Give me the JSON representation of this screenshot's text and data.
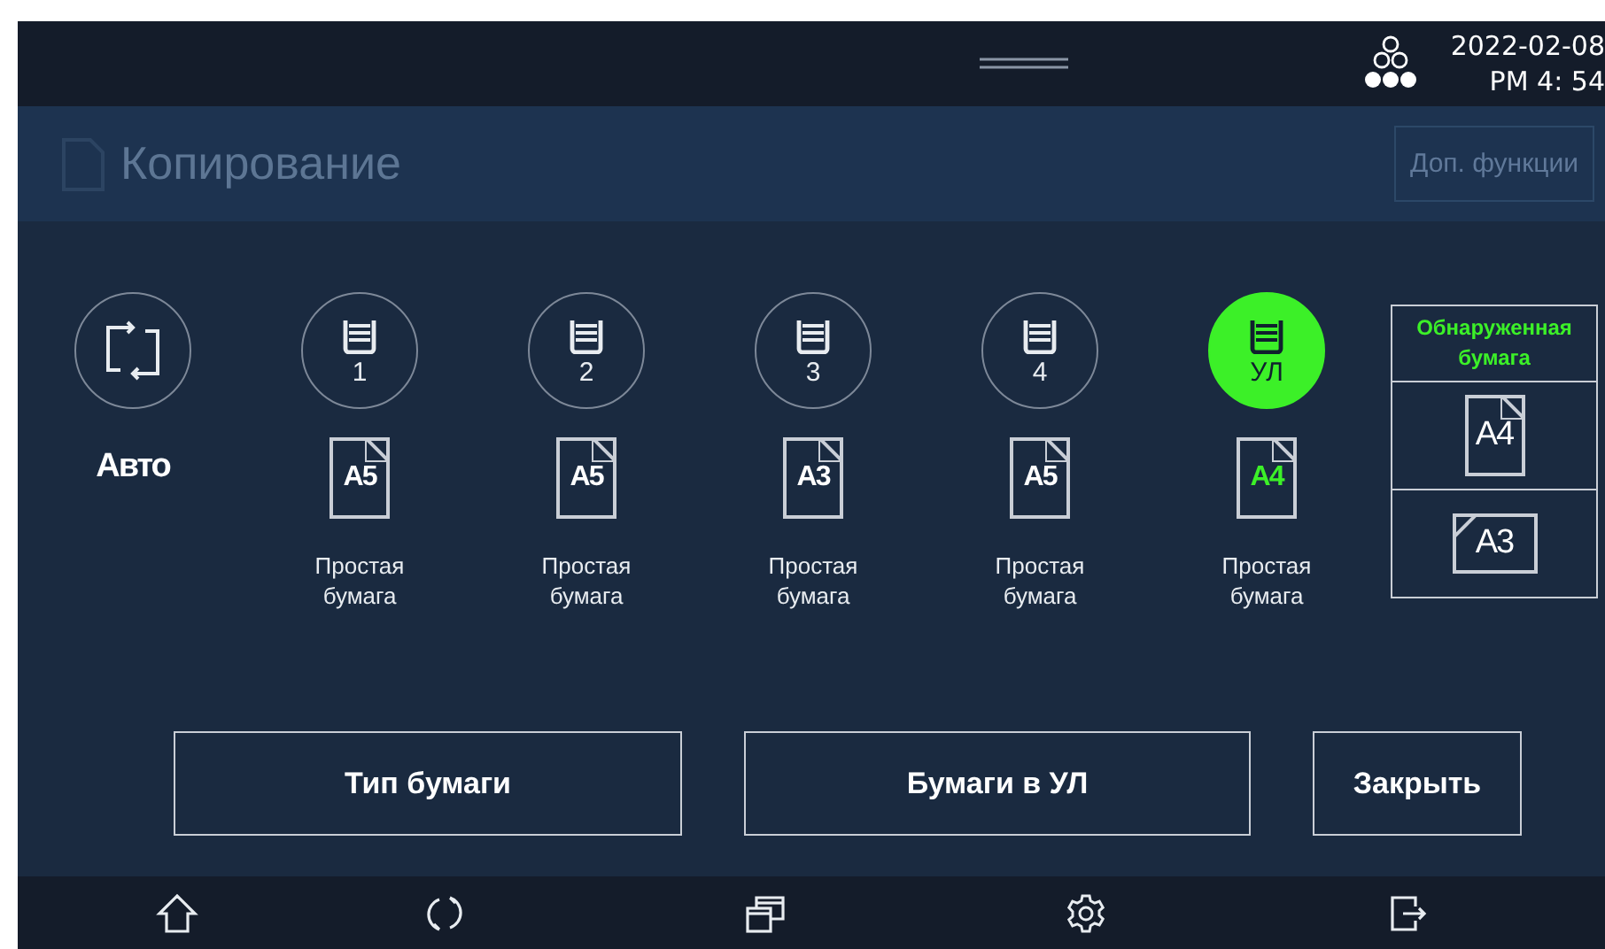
{
  "status_bar": {
    "date": "2022-02-08",
    "time": "PM 4: 54"
  },
  "background": {
    "title": "Копирование",
    "button": "Доп. функции"
  },
  "trays": [
    {
      "kind": "auto",
      "label": "Авто",
      "selected": false
    },
    {
      "kind": "tray",
      "label": "1",
      "paper_size": "A5",
      "paper_type": "Простая бумага",
      "selected": false
    },
    {
      "kind": "tray",
      "label": "2",
      "paper_size": "A5",
      "paper_type": "Простая бумага",
      "selected": false
    },
    {
      "kind": "tray",
      "label": "3",
      "paper_size": "A3",
      "paper_type": "Простая бумага",
      "selected": false
    },
    {
      "kind": "tray",
      "label": "4",
      "paper_size": "A5",
      "paper_type": "Простая бумага",
      "selected": false
    },
    {
      "kind": "tray",
      "label": "УЛ",
      "paper_size": "A4",
      "paper_type": "Простая бумага",
      "selected": true
    }
  ],
  "detected": {
    "title": "Обнаруженная бумага",
    "papers": [
      {
        "size": "A4",
        "kind": "portrait"
      },
      {
        "size": "A3",
        "kind": "landscape"
      }
    ]
  },
  "buttons": [
    "Тип бумаги",
    "Бумаги в УЛ",
    "Закрыть"
  ]
}
